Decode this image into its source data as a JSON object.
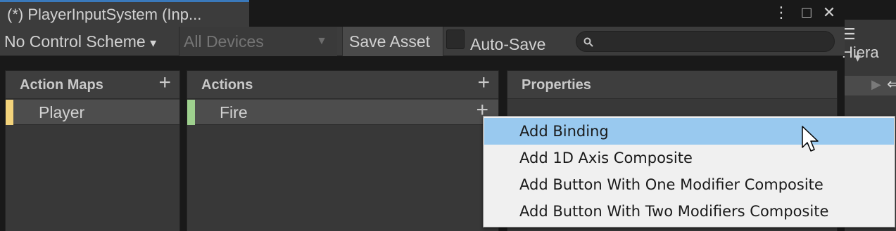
{
  "window": {
    "title": "(*) PlayerInputSystem (Inp...",
    "more_icon": "⋮",
    "maximize_icon": "□",
    "close_icon": "✕"
  },
  "toolbar": {
    "control_scheme": "No Control Scheme",
    "control_scheme_arrow": "▾",
    "devices": "All Devices",
    "devices_arrow": "▼",
    "save_asset": "Save Asset",
    "auto_save": "Auto-Save",
    "search_placeholder": ""
  },
  "right_panel": {
    "tab_label": "☰ Hiera",
    "dropdown_arrow": "▾"
  },
  "panels": {
    "action_maps": {
      "title": "Action Maps",
      "items": [
        {
          "label": "Player",
          "color": "#f3d37b"
        }
      ]
    },
    "actions": {
      "title": "Actions",
      "items": [
        {
          "label": "Fire",
          "color": "#9ed08e"
        }
      ]
    },
    "properties": {
      "title": "Properties"
    }
  },
  "context_menu": {
    "items": [
      {
        "label": "Add Binding",
        "highlighted": true
      },
      {
        "label": "Add 1D Axis Composite",
        "highlighted": false
      },
      {
        "label": "Add Button With One Modifier Composite",
        "highlighted": false
      },
      {
        "label": "Add Button With Two Modifiers Composite",
        "highlighted": false
      }
    ]
  },
  "colors": {
    "accent_tab": "#3a79bb",
    "menu_highlight": "#99c9ef"
  }
}
